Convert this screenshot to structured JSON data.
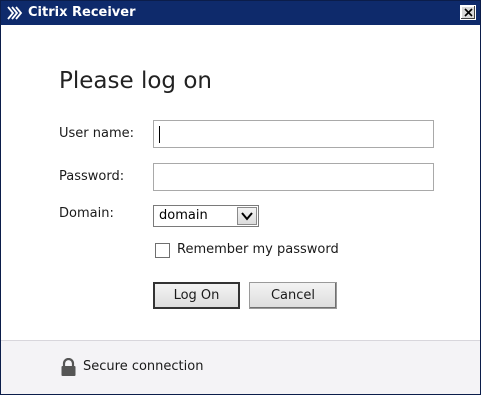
{
  "window": {
    "title": "Citrix Receiver",
    "logo_icon": "citrix-logo-icon",
    "close_icon": "close-icon",
    "titlebar_color": "#0e2a6b"
  },
  "form": {
    "heading": "Please log on",
    "username_label": "User name:",
    "username_value": "",
    "password_label": "Password:",
    "password_value": "",
    "domain_label": "Domain:",
    "domain_selected": "domain",
    "domain_options": [
      "domain"
    ],
    "remember_label": "Remember my password",
    "remember_checked": false,
    "logon_label": "Log On",
    "cancel_label": "Cancel"
  },
  "footer": {
    "icon": "lock-icon",
    "status_text": "Secure connection"
  }
}
